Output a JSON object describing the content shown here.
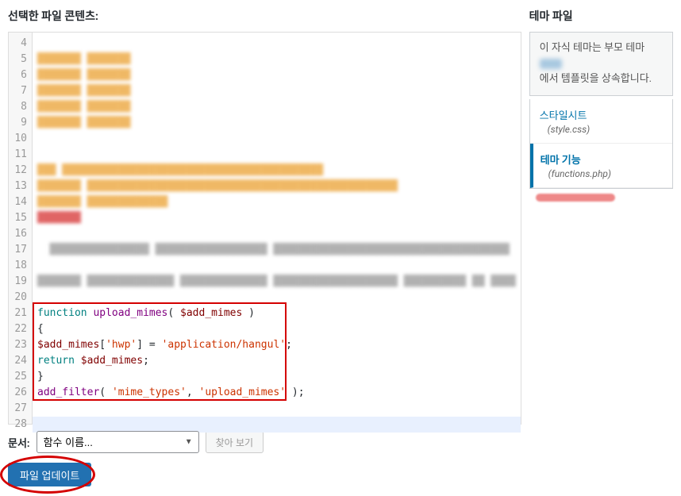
{
  "left": {
    "heading": "선택한 파일 콘텐츠:",
    "gutter_start": 4,
    "gutter_end": 28,
    "code": {
      "l21_kw": "function",
      "l21_fn": "upload_mimes",
      "l21_var": "$add_mimes",
      "l22": "{",
      "l23_var": "$add_mimes",
      "l23_key": "'hwp'",
      "l23_val": "'application/hangul'",
      "l24_kw": "return",
      "l24_var": "$add_mimes",
      "l25": "}",
      "l26_fn": "add_filter",
      "l26_arg1": "'mime_types'",
      "l26_arg2": "'upload_mimes'"
    },
    "controls": {
      "label": "문서:",
      "select_placeholder": "함수 이름...",
      "lookup": "찾아 보기"
    },
    "update_button": "파일 업데이트"
  },
  "right": {
    "heading": "테마 파일",
    "desc_prefix": "이 자식 테마는 부모 테마 ",
    "desc_suffix": "에서 템플릿을 상속합니다.",
    "files": [
      {
        "title": "스타일시트",
        "filename": "(style.css)"
      },
      {
        "title": "테마 기능",
        "filename": "(functions.php)"
      }
    ]
  }
}
